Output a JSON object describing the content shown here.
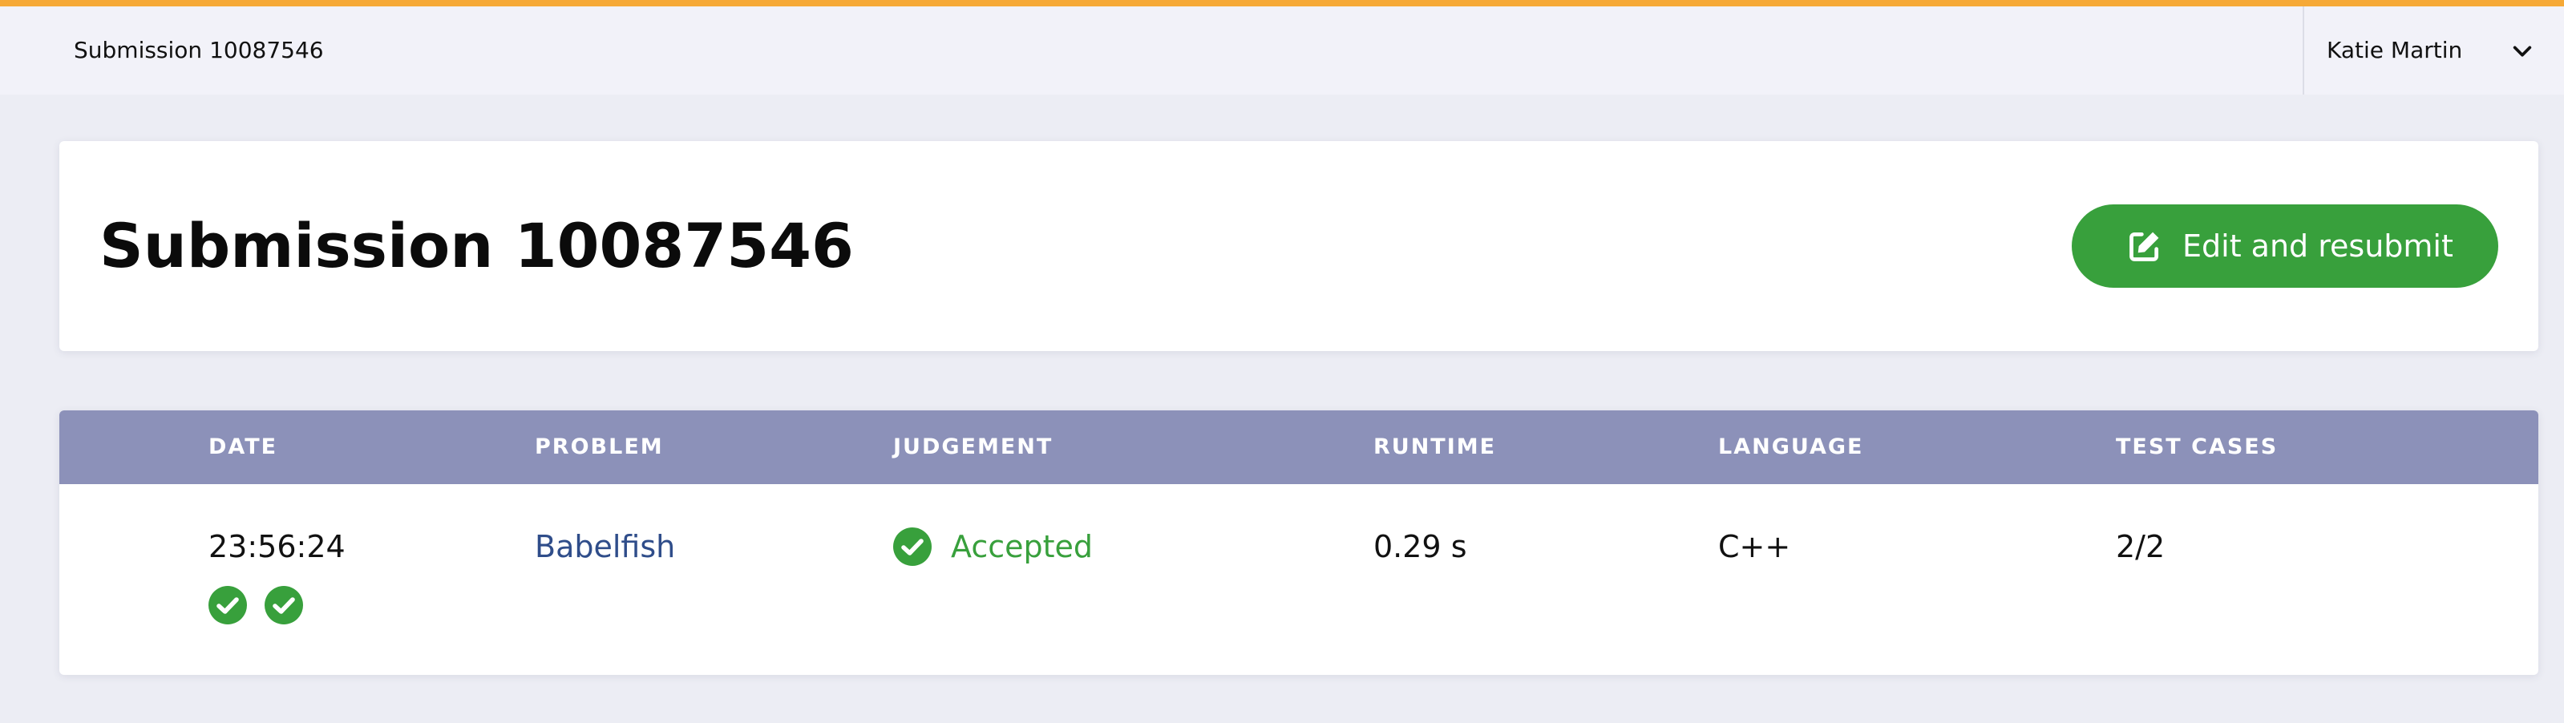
{
  "colors": {
    "accent_bar": "#f6a937",
    "accepted_green": "#38a03c",
    "table_header_bg": "#8c91b9",
    "link_blue": "#2f4d8a"
  },
  "topbar": {
    "breadcrumb": "Submission 10087546",
    "user_name": "Katie Martin",
    "user_menu_icon": "chevron-down-icon"
  },
  "header": {
    "title": "Submission 10087546",
    "resubmit_label": "Edit and resubmit",
    "resubmit_icon": "edit-icon"
  },
  "submission_table": {
    "columns": [
      "DATE",
      "PROBLEM",
      "JUDGEMENT",
      "RUNTIME",
      "LANGUAGE",
      "TEST CASES"
    ],
    "row": {
      "date": "23:56:24",
      "problem": "Babelfish",
      "judgement": "Accepted",
      "judgement_icon": "check-circle-icon",
      "runtime": "0.29 s",
      "language": "C++",
      "test_cases": "2/2"
    },
    "test_case_results": [
      "accepted",
      "accepted"
    ]
  }
}
